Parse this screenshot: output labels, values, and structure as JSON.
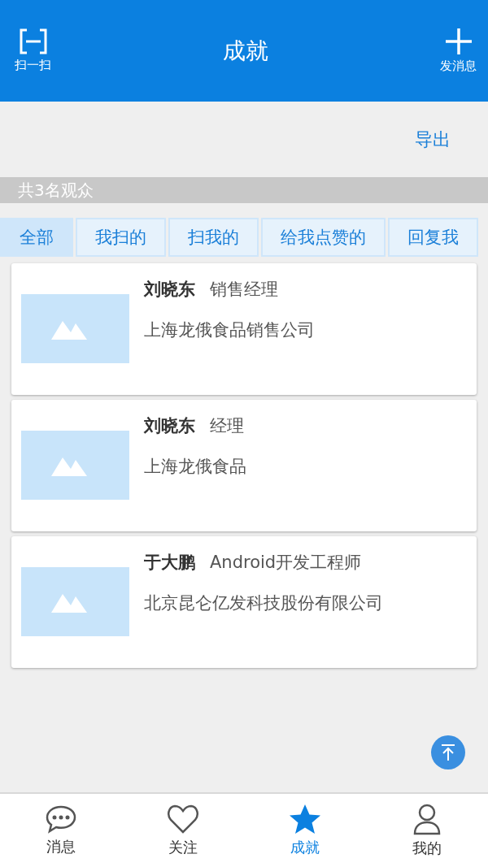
{
  "header": {
    "title": "成就",
    "left": "扫一扫",
    "right": "发消息"
  },
  "export": "导出",
  "summary": "共3名观众",
  "tabs": [
    {
      "label": "全部",
      "selected": true
    },
    {
      "label": "我扫的",
      "selected": false
    },
    {
      "label": "扫我的",
      "selected": false
    },
    {
      "label": "给我点赞的",
      "selected": false
    },
    {
      "label": "回复我",
      "selected": false
    }
  ],
  "cards": [
    {
      "name": "刘晓东",
      "title": "销售经理",
      "company": "上海龙俄食品销售公司"
    },
    {
      "name": "刘晓东",
      "title": "经理",
      "company": "上海龙俄食品"
    },
    {
      "name": "于大鹏",
      "title": "Android开发工程师",
      "company": "北京昆仑亿发科技股份有限公司"
    }
  ],
  "nav": [
    {
      "label": "消息",
      "kind": "chat",
      "selected": false
    },
    {
      "label": "关注",
      "kind": "heart",
      "selected": false
    },
    {
      "label": "成就",
      "kind": "star",
      "selected": true
    },
    {
      "label": "我的",
      "kind": "person",
      "selected": false
    }
  ]
}
